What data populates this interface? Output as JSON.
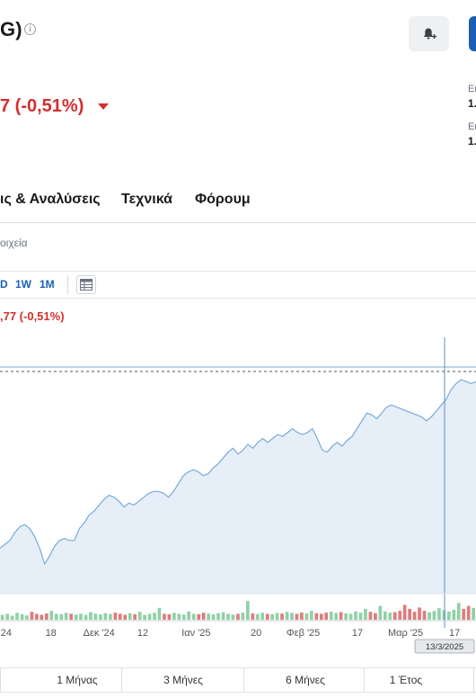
{
  "header": {
    "ticker_fragment": "G)",
    "info_icon": "info-icon",
    "alert_icon": "bell-plus-icon",
    "price_change": "7 (-0,51%)"
  },
  "side_panel": {
    "label_1": "Ει",
    "value_1": "1.",
    "label_2": "Ει",
    "value_2": "1."
  },
  "tabs": [
    {
      "label": "ις & Αναλύσεις"
    },
    {
      "label": "Τεχνικά"
    },
    {
      "label": "Φόρουμ"
    }
  ],
  "sub_label": "οιχεία",
  "range_buttons": [
    {
      "label": "D"
    },
    {
      "label": "1W"
    },
    {
      "label": "1M"
    }
  ],
  "chart_type_icon": "table-icon",
  "chart_change": ",77 (-0,51%)",
  "chart_data": {
    "type": "area",
    "x_tick_labels": [
      "24",
      "18",
      "Δεκ '24",
      "12",
      "Ιαν '25",
      "20",
      "Φεβ '25",
      "17",
      "Μαρ '25",
      "17"
    ],
    "x_ticks_fraction": [
      0.013,
      0.107,
      0.208,
      0.3,
      0.412,
      0.538,
      0.637,
      0.751,
      0.852,
      0.955
    ],
    "crosshair_label": "13/3/2025",
    "crosshair_fraction": 0.934,
    "reference_level": 0.92,
    "line_color": "#7aaad8",
    "fill_color": "#e6eef7",
    "series": [
      0.14,
      0.16,
      0.18,
      0.22,
      0.25,
      0.26,
      0.24,
      0.2,
      0.14,
      0.06,
      0.1,
      0.15,
      0.18,
      0.19,
      0.18,
      0.18,
      0.24,
      0.27,
      0.31,
      0.33,
      0.36,
      0.39,
      0.41,
      0.4,
      0.38,
      0.35,
      0.37,
      0.36,
      0.38,
      0.4,
      0.42,
      0.43,
      0.43,
      0.42,
      0.4,
      0.43,
      0.47,
      0.51,
      0.53,
      0.54,
      0.53,
      0.51,
      0.52,
      0.55,
      0.57,
      0.6,
      0.63,
      0.65,
      0.62,
      0.64,
      0.67,
      0.65,
      0.68,
      0.7,
      0.68,
      0.7,
      0.72,
      0.71,
      0.73,
      0.75,
      0.73,
      0.72,
      0.73,
      0.75,
      0.7,
      0.64,
      0.63,
      0.66,
      0.68,
      0.66,
      0.69,
      0.71,
      0.75,
      0.79,
      0.83,
      0.82,
      0.8,
      0.83,
      0.86,
      0.87,
      0.86,
      0.85,
      0.84,
      0.83,
      0.82,
      0.81,
      0.79,
      0.81,
      0.84,
      0.87,
      0.9,
      0.95,
      0.98,
      1.0,
      0.99,
      0.98,
      0.99
    ],
    "volume": [
      0.25,
      0.3,
      0.2,
      0.35,
      0.28,
      0.22,
      0.4,
      0.3,
      0.25,
      0.32,
      0.45,
      0.3,
      0.28,
      0.35,
      0.3,
      0.26,
      0.3,
      0.24,
      0.38,
      0.31,
      0.27,
      0.33,
      0.29,
      0.36,
      0.3,
      0.25,
      0.33,
      0.28,
      0.4,
      0.24,
      0.3,
      0.35,
      0.6,
      0.3,
      0.28,
      0.35,
      0.3,
      0.26,
      0.42,
      0.3,
      0.28,
      0.36,
      0.31,
      0.27,
      0.33,
      0.38,
      0.3,
      0.26,
      0.3,
      0.36,
      0.95,
      0.32,
      0.29,
      0.35,
      0.3,
      0.28,
      0.34,
      0.31,
      0.4,
      0.35,
      0.3,
      0.36,
      0.32,
      0.45,
      0.33,
      0.3,
      0.36,
      0.41,
      0.34,
      0.38,
      0.32,
      0.3,
      0.42,
      0.36,
      0.55,
      0.4,
      0.33,
      0.7,
      0.42,
      0.36,
      0.38,
      0.45,
      0.75,
      0.55,
      0.4,
      0.62,
      0.45,
      0.38,
      0.44,
      0.58,
      0.48,
      0.42,
      0.5,
      0.85,
      0.55,
      0.7,
      0.6
    ],
    "volume_up_color": "#8fd1a7",
    "volume_down_color": "#e07b7b"
  },
  "periods": [
    {
      "label": "1 Μήνας"
    },
    {
      "label": "3 Μήνες"
    },
    {
      "label": "6 Μήνες"
    },
    {
      "label": "1 Έτος"
    }
  ]
}
